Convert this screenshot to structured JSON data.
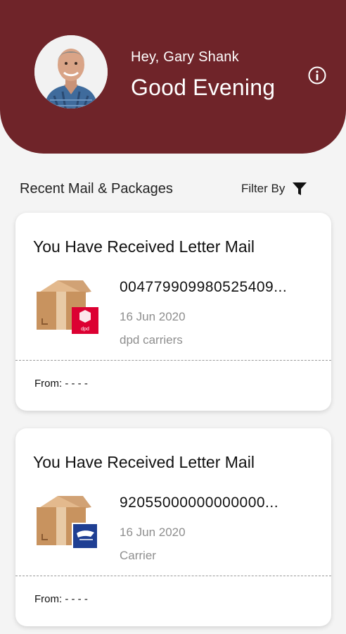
{
  "header": {
    "greeting": "Hey, Gary Shank",
    "salutation": "Good Evening",
    "background_color": "#6f2429",
    "info_icon": "info-icon",
    "avatar": "profile-photo"
  },
  "section": {
    "title": "Recent Mail & Packages",
    "filter_label": "Filter By",
    "filter_icon": "funnel-icon"
  },
  "cards": [
    {
      "title": "You Have Received Letter Mail",
      "tracking": "004779909980525409...",
      "date": "16 Jun 2020",
      "carrier": "dpd carriers",
      "carrier_badge": "dpd",
      "carrier_badge_color": "#dc0032",
      "from": "From: - - - -"
    },
    {
      "title": "You Have Received Letter Mail",
      "tracking": "92055000000000000...",
      "date": "16 Jun 2020",
      "carrier": "Carrier",
      "carrier_badge_color": "#1f3f93",
      "from": "From: - - - -"
    }
  ]
}
